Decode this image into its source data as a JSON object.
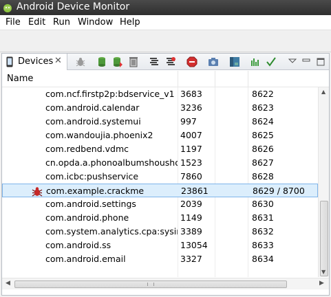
{
  "window": {
    "title": "Android Device Monitor"
  },
  "menu": [
    "File",
    "Edit",
    "Run",
    "Window",
    "Help"
  ],
  "view": {
    "tab_label": "Devices",
    "tab_close": "✕",
    "column_header": "Name"
  },
  "processes": [
    {
      "name": "com.ncf.firstp2p:bdservice_v1",
      "pid": "3683",
      "port": "8622",
      "debug": false,
      "selected": false
    },
    {
      "name": "com.android.calendar",
      "pid": "3236",
      "port": "8623",
      "debug": false,
      "selected": false
    },
    {
      "name": "com.android.systemui",
      "pid": "997",
      "port": "8624",
      "debug": false,
      "selected": false
    },
    {
      "name": "com.wandoujia.phoenix2",
      "pid": "4007",
      "port": "8625",
      "debug": false,
      "selected": false
    },
    {
      "name": "com.redbend.vdmc",
      "pid": "1197",
      "port": "8626",
      "debug": false,
      "selected": false
    },
    {
      "name": "cn.opda.a.phonoalbumshoushou",
      "pid": "1523",
      "port": "8627",
      "debug": false,
      "selected": false
    },
    {
      "name": "com.icbc:pushservice",
      "pid": "7860",
      "port": "8628",
      "debug": false,
      "selected": false
    },
    {
      "name": "com.example.crackme",
      "pid": "23861",
      "port": "8629 / 8700",
      "debug": true,
      "selected": true
    },
    {
      "name": "com.android.settings",
      "pid": "2039",
      "port": "8630",
      "debug": false,
      "selected": false
    },
    {
      "name": "com.android.phone",
      "pid": "1149",
      "port": "8631",
      "debug": false,
      "selected": false
    },
    {
      "name": "com.system.analytics.cpa:sysinter",
      "pid": "3389",
      "port": "8632",
      "debug": false,
      "selected": false
    },
    {
      "name": "com.android.ss",
      "pid": "13054",
      "port": "8633",
      "debug": false,
      "selected": false
    },
    {
      "name": "com.android.email",
      "pid": "3327",
      "port": "8634",
      "debug": false,
      "selected": false
    }
  ],
  "toolbar_icons": [
    "debug-process-icon",
    "update-heap-icon",
    "dump-hprof-icon",
    "cause-gc-icon",
    "update-threads-icon",
    "start-method-profiling-icon",
    "stop-process-icon",
    "screen-capture-icon",
    "dump-view-hierarchy-icon",
    "capture-opengl-trace-icon",
    "reset-adb-icon",
    "view-menu-icon",
    "minimize-icon",
    "maximize-icon"
  ],
  "colors": {
    "selection_bg": "#dceefc",
    "selection_border": "#7eb4ea",
    "titlebar": "#3a3a3a"
  }
}
